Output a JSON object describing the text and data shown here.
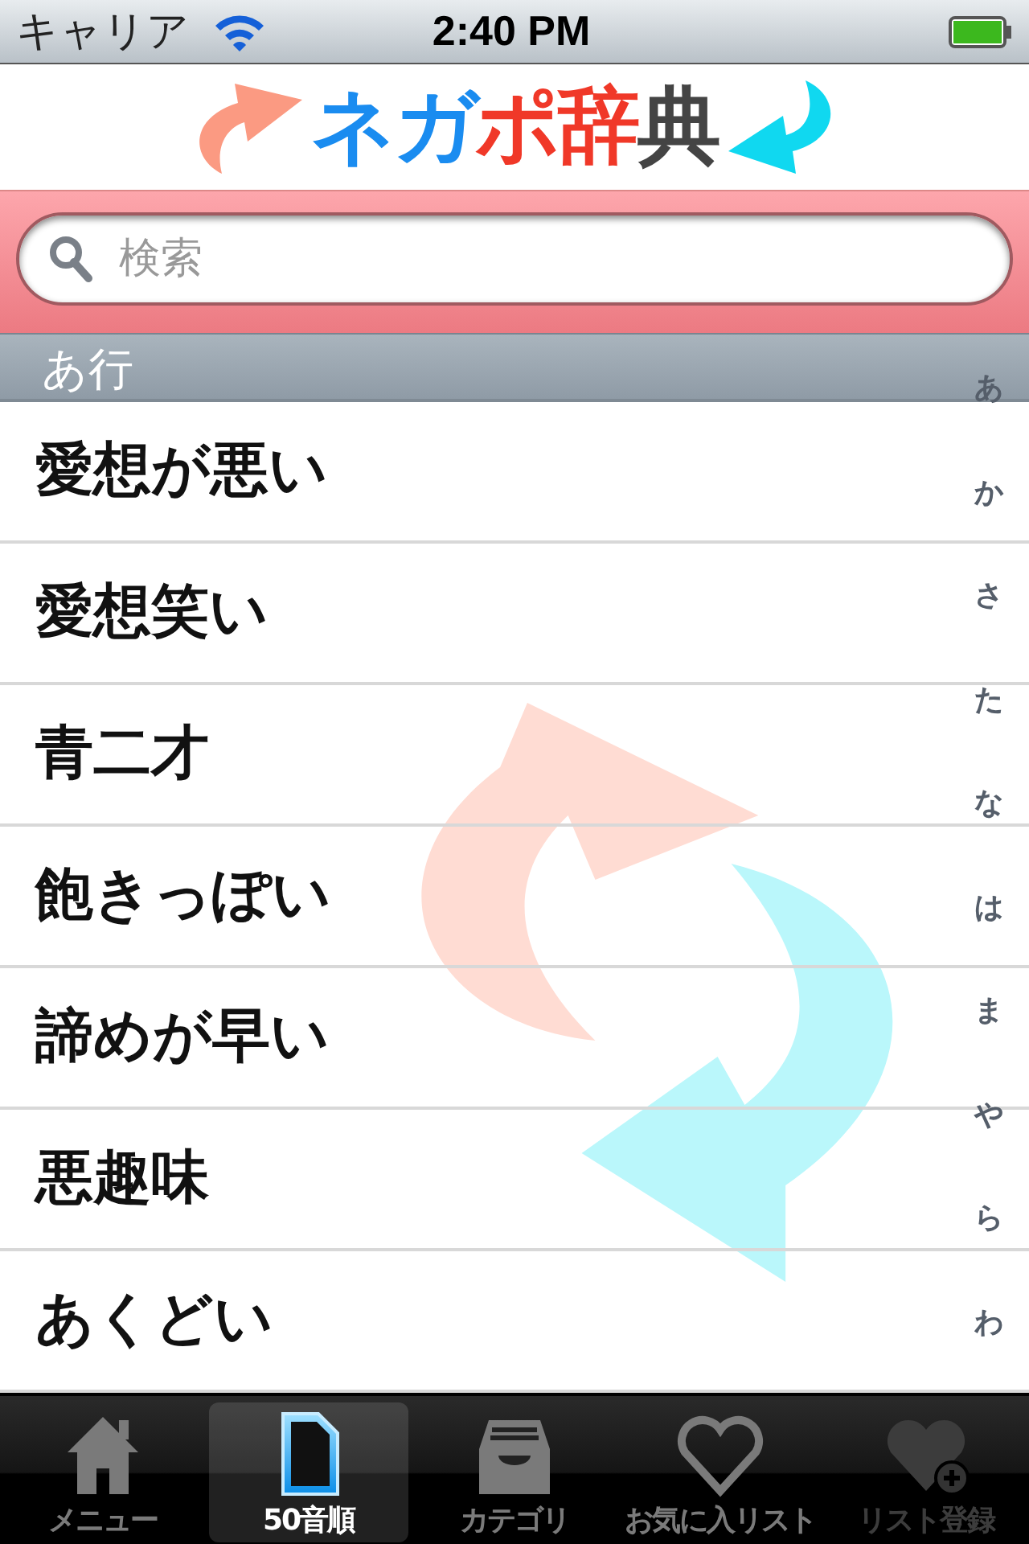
{
  "status_bar": {
    "carrier": "キャリア",
    "time": "2:40 PM"
  },
  "logo": {
    "parts": [
      {
        "text": "ネガ",
        "color": "#1a8cf0"
      },
      {
        "text": "ポ辞",
        "color": "#f03828"
      },
      {
        "text": "典",
        "color": "#444444"
      }
    ]
  },
  "search": {
    "placeholder": "検索"
  },
  "section": {
    "title": "あ行"
  },
  "rows": [
    "愛想が悪い",
    "愛想笑い",
    "青二才",
    "飽きっぽい",
    "諦めが早い",
    "悪趣味",
    "あくどい"
  ],
  "index": [
    "あ",
    "か",
    "さ",
    "た",
    "な",
    "は",
    "ま",
    "や",
    "ら",
    "わ"
  ],
  "tab_bar": [
    {
      "kind": "home",
      "label": "メニュー",
      "selected": false,
      "disabled": false
    },
    {
      "kind": "document",
      "label": "50音順",
      "selected": true,
      "disabled": false
    },
    {
      "kind": "tray",
      "label": "カテゴリ",
      "selected": false,
      "disabled": false
    },
    {
      "kind": "heart",
      "label": "お気に入リスト",
      "selected": false,
      "disabled": false
    },
    {
      "kind": "heart-plus",
      "label": "リスト登録",
      "selected": false,
      "disabled": true
    }
  ]
}
